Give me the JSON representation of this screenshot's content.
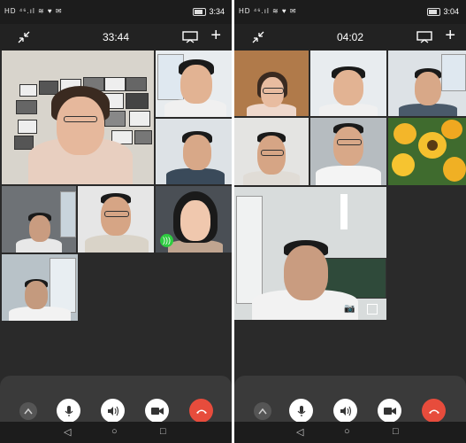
{
  "left_screen": {
    "status_time": "3:34",
    "status_icons": "HD ⁴⁶.ıl ≋ ♥ ✉",
    "call_duration": "33:44"
  },
  "right_screen": {
    "status_time": "3:04",
    "status_icons": "HD ⁴⁶.ıl ≋ ♥ ✉",
    "call_duration": "04:02"
  },
  "icons": {
    "collapse": "collapse-arrows-icon",
    "screen_share": "screen-icon",
    "add": "plus-icon",
    "expand": "chevron-up-icon",
    "mic": "microphone-icon",
    "speaker": "speaker-icon",
    "camera": "video-camera-icon",
    "hangup": "hang-up-icon",
    "nav_back": "triangle-back-icon",
    "nav_home": "circle-home-icon",
    "nav_recent": "square-recent-icon"
  },
  "colors": {
    "hangup_red": "#e74c3c",
    "speaking_green": "#2ecc40",
    "background_dark": "#2a2a2a"
  }
}
